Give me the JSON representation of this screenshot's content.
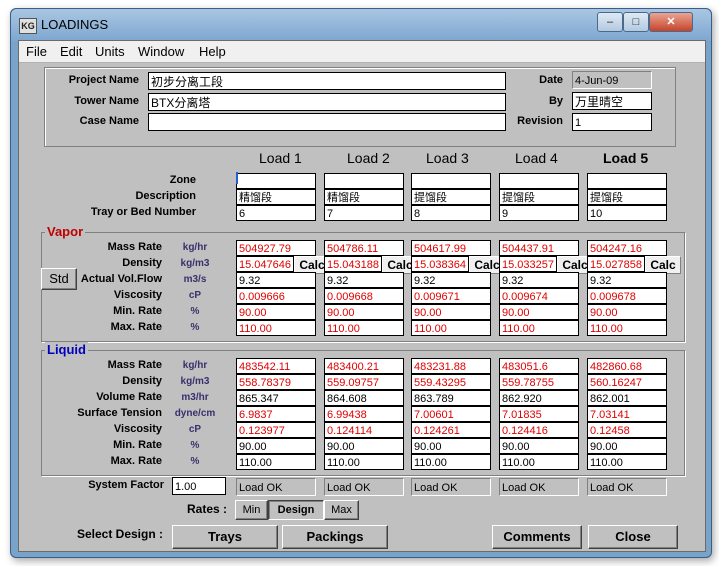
{
  "window": {
    "title": "LOADINGS",
    "icon_text": "KG",
    "controls": {
      "minimize": "–",
      "restore": "□",
      "close": "✕"
    }
  },
  "menu": [
    "File",
    "Edit",
    "Units",
    "Window",
    "Help"
  ],
  "header": {
    "project_label": "Project Name",
    "project_value": "初步分离工段",
    "tower_label": "Tower Name",
    "tower_value": "BTX分离塔",
    "case_label": "Case Name",
    "case_value": "",
    "date_label": "Date",
    "date_value": "4-Jun-09",
    "by_label": "By",
    "by_value": "万里晴空",
    "revision_label": "Revision",
    "revision_value": "1"
  },
  "loads": [
    "Load 1",
    "Load 2",
    "Load 3",
    "Load 4",
    "Load 5"
  ],
  "row_labels": {
    "zone": "Zone",
    "description": "Description",
    "tray": "Tray or Bed Number"
  },
  "zone": [
    "",
    "",
    "",
    "",
    ""
  ],
  "description": [
    "精馏段",
    "精馏段",
    "提馏段",
    "提馏段",
    "提馏段"
  ],
  "tray": [
    "6",
    "7",
    "8",
    "9",
    "10"
  ],
  "vapor": {
    "title": "Vapor",
    "std_label": "Std",
    "calc_label": "Calc",
    "rows": [
      {
        "label": "Mass Rate",
        "unit": "kg/hr",
        "values": [
          "504927.79",
          "504786.11",
          "504617.99",
          "504437.91",
          "504247.16"
        ],
        "red": true
      },
      {
        "label": "Density",
        "unit": "kg/m3",
        "values": [
          "15.047646",
          "15.043188",
          "15.038364",
          "15.033257",
          "15.027858"
        ],
        "red": true
      },
      {
        "label": "Actual Vol.Flow",
        "unit": "m3/s",
        "values": [
          "9.32",
          "9.32",
          "9.32",
          "9.32",
          "9.32"
        ],
        "red": false
      },
      {
        "label": "Viscosity",
        "unit": "cP",
        "values": [
          "0.009666",
          "0.009668",
          "0.009671",
          "0.009674",
          "0.009678"
        ],
        "red": true
      },
      {
        "label": "Min. Rate",
        "unit": "%",
        "values": [
          "90.00",
          "90.00",
          "90.00",
          "90.00",
          "90.00"
        ],
        "red": true
      },
      {
        "label": "Max. Rate",
        "unit": "%",
        "values": [
          "110.00",
          "110.00",
          "110.00",
          "110.00",
          "110.00"
        ],
        "red": true
      }
    ]
  },
  "liquid": {
    "title": "Liquid",
    "rows": [
      {
        "label": "Mass Rate",
        "unit": "kg/hr",
        "values": [
          "483542.11",
          "483400.21",
          "483231.88",
          "483051.6",
          "482860.68"
        ],
        "red": true
      },
      {
        "label": "Density",
        "unit": "kg/m3",
        "values": [
          "558.78379",
          "559.09757",
          "559.43295",
          "559.78755",
          "560.16247"
        ],
        "red": true
      },
      {
        "label": "Volume Rate",
        "unit": "m3/hr",
        "values": [
          "865.347",
          "864.608",
          "863.789",
          "862.920",
          "862.001"
        ],
        "red": false
      },
      {
        "label": "Surface Tension",
        "unit": "dyne/cm",
        "values": [
          "6.9837",
          "6.99438",
          "7.00601",
          "7.01835",
          "7.03141"
        ],
        "red": true
      },
      {
        "label": "Viscosity",
        "unit": "cP",
        "values": [
          "0.123977",
          "0.124114",
          "0.124261",
          "0.124416",
          "0.12458"
        ],
        "red": true
      },
      {
        "label": "Min. Rate",
        "unit": "%",
        "values": [
          "90.00",
          "90.00",
          "90.00",
          "90.00",
          "90.00"
        ],
        "red": false
      },
      {
        "label": "Max. Rate",
        "unit": "%",
        "values": [
          "110.00",
          "110.00",
          "110.00",
          "110.00",
          "110.00"
        ],
        "red": false
      }
    ]
  },
  "system_factor_label": "System Factor",
  "system_factor_value": "1.00",
  "status": [
    "Load OK",
    "Load OK",
    "Load OK",
    "Load OK",
    "Load OK"
  ],
  "rates_label": "Rates :",
  "rates": [
    "Min",
    "Design",
    "Max"
  ],
  "select_design_label": "Select Design :",
  "buttons": {
    "trays": "Trays",
    "packings": "Packings",
    "comments": "Comments",
    "close": "Close"
  },
  "colors": {
    "vapor_title": "#c00000",
    "liquid_title": "#0000c0",
    "value_red": "#e00000",
    "unit": "#3a2f6b"
  }
}
